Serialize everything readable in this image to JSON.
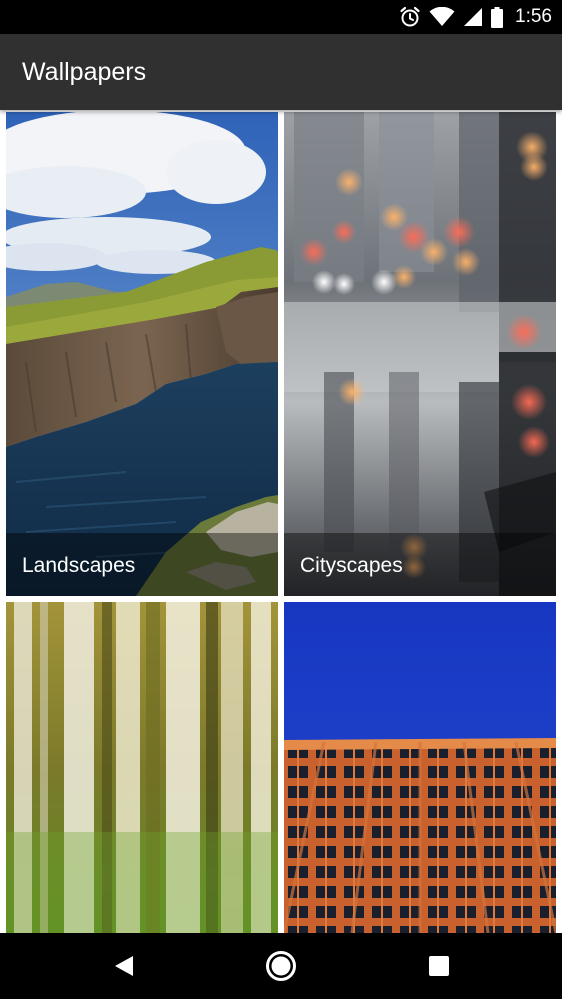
{
  "status_bar": {
    "time": "1:56",
    "icons": [
      "alarm-icon",
      "wifi-icon",
      "cell-signal-icon",
      "battery-icon"
    ]
  },
  "app_bar": {
    "title": "Wallpapers",
    "background": "#303030"
  },
  "categories": [
    {
      "label": "Landscapes",
      "image": "sea-cliff-landscape"
    },
    {
      "label": "Cityscapes",
      "image": "rainy-city-street-bokeh"
    },
    {
      "label": "",
      "image": "blurred-birch-forest"
    },
    {
      "label": "",
      "image": "orange-building-facade-blue-sky"
    }
  ],
  "nav_bar": {
    "buttons": [
      "back-icon",
      "home-icon",
      "recents-icon"
    ]
  }
}
